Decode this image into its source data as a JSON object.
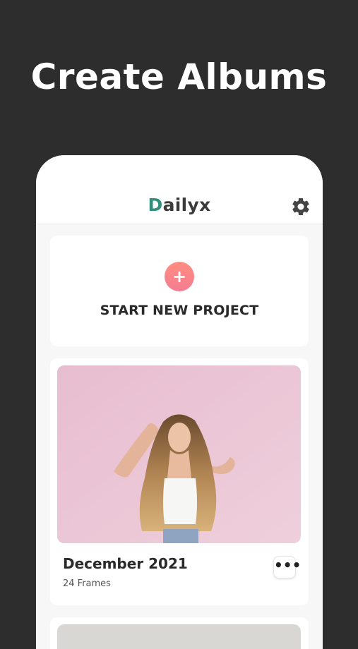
{
  "headline": "Create Albums",
  "app": {
    "logo_initial": "D",
    "logo_rest": "ailyx",
    "settings_icon": "gear-icon"
  },
  "new_project": {
    "plus_symbol": "+",
    "label": "START NEW PROJECT",
    "accent": "#f47c93"
  },
  "album": {
    "title": "December 2021",
    "frames": "24 Frames",
    "more_symbol": "•••"
  }
}
